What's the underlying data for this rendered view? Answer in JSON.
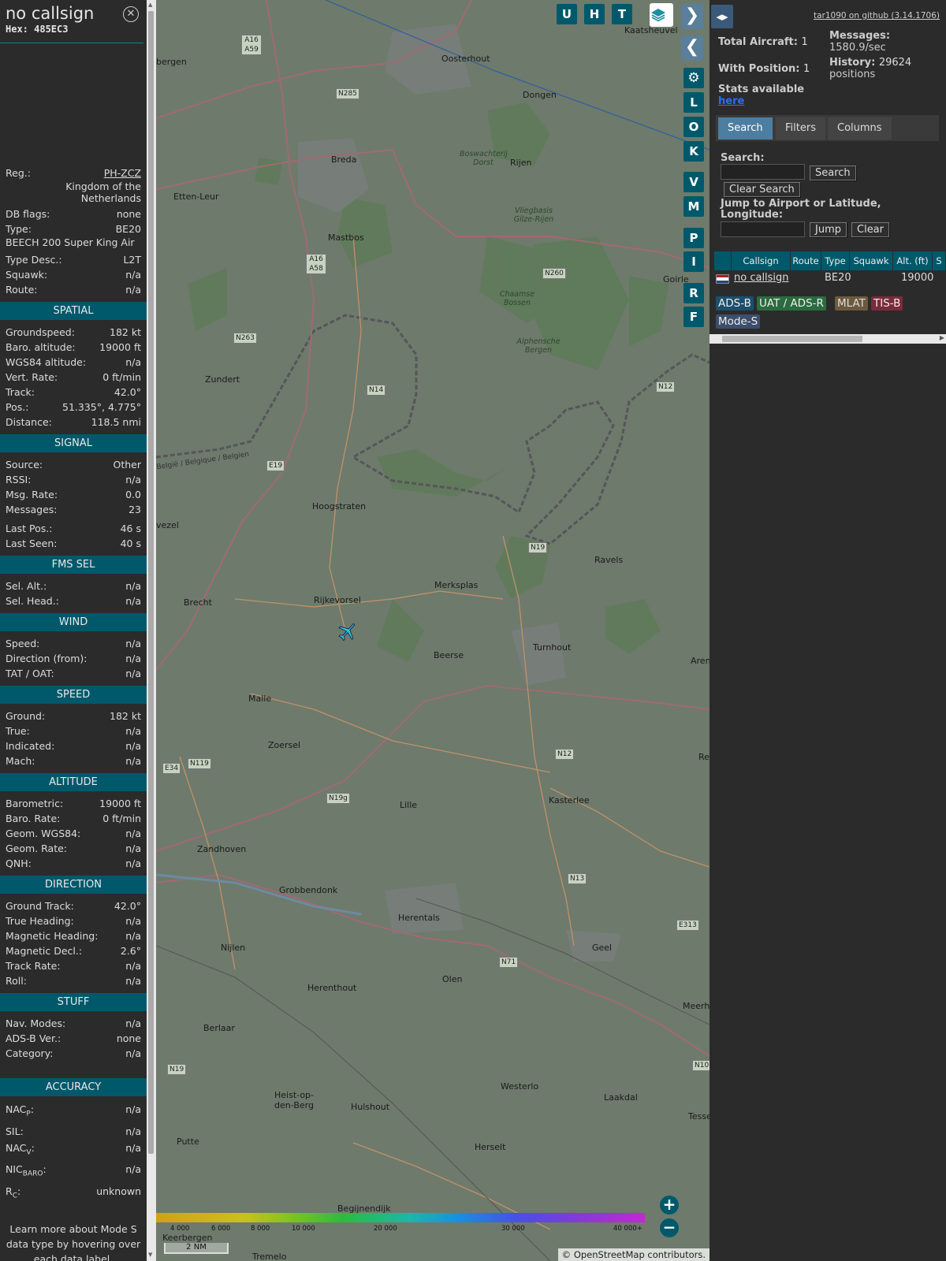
{
  "info": {
    "callsign": "no callsign",
    "hex": "Hex: 485EC3",
    "close_icon": "close-icon",
    "top_rows": [
      {
        "label": "Reg.:",
        "value": "PH-ZCZ"
      },
      {
        "label": "",
        "value": "Kingdom of the Netherlands"
      },
      {
        "label": "DB flags:",
        "value": "none"
      },
      {
        "label": "Type:",
        "value": "BE20"
      },
      {
        "label": "",
        "value": "BEECH 200 Super King Air"
      },
      {
        "label": "Type Desc.:",
        "value": "L2T"
      },
      {
        "label": "Squawk:",
        "value": "n/a"
      },
      {
        "label": "Route:",
        "value": "n/a"
      }
    ],
    "sections": [
      {
        "title": "SPATIAL",
        "rows": [
          {
            "label": "Groundspeed:",
            "value": "182 kt"
          },
          {
            "label": "Baro. altitude:",
            "value": "19000 ft"
          },
          {
            "label": "WGS84 altitude:",
            "value": "n/a"
          },
          {
            "label": "Vert. Rate:",
            "value": "0 ft/min"
          },
          {
            "label": "Track:",
            "value": "42.0°"
          },
          {
            "label": "Pos.:",
            "value": "51.335°, 4.775°"
          },
          {
            "label": "Distance:",
            "value": "118.5 nmi"
          }
        ]
      },
      {
        "title": "SIGNAL",
        "rows": [
          {
            "label": "Source:",
            "value": "Other"
          },
          {
            "label": "RSSI:",
            "value": "n/a"
          },
          {
            "label": "Msg. Rate:",
            "value": "0.0"
          },
          {
            "label": "Messages:",
            "value": "23"
          },
          {
            "label": "Last Pos.:",
            "value": "46 s"
          },
          {
            "label": "Last Seen:",
            "value": "40 s"
          }
        ]
      },
      {
        "title": "FMS SEL",
        "rows": [
          {
            "label": "Sel. Alt.:",
            "value": "n/a"
          },
          {
            "label": "Sel. Head.:",
            "value": "n/a"
          }
        ]
      },
      {
        "title": "WIND",
        "rows": [
          {
            "label": "Speed:",
            "value": "n/a"
          },
          {
            "label": "Direction (from):",
            "value": "n/a"
          },
          {
            "label": "TAT / OAT:",
            "value": "n/a"
          }
        ]
      },
      {
        "title": "SPEED",
        "rows": [
          {
            "label": "Ground:",
            "value": "182 kt"
          },
          {
            "label": "True:",
            "value": "n/a"
          },
          {
            "label": "Indicated:",
            "value": "n/a"
          },
          {
            "label": "Mach:",
            "value": "n/a"
          }
        ]
      },
      {
        "title": "ALTITUDE",
        "rows": [
          {
            "label": "Barometric:",
            "value": "19000 ft"
          },
          {
            "label": "Baro. Rate:",
            "value": "0 ft/min"
          },
          {
            "label": "Geom. WGS84:",
            "value": "n/a"
          },
          {
            "label": "Geom. Rate:",
            "value": "n/a"
          },
          {
            "label": "QNH:",
            "value": "n/a"
          }
        ]
      },
      {
        "title": "DIRECTION",
        "rows": [
          {
            "label": "Ground Track:",
            "value": "42.0°"
          },
          {
            "label": "True Heading:",
            "value": "n/a"
          },
          {
            "label": "Magnetic Heading:",
            "value": "n/a"
          },
          {
            "label": "Magnetic Decl.:",
            "value": "2.6°"
          },
          {
            "label": "Track Rate:",
            "value": "n/a"
          },
          {
            "label": "Roll:",
            "value": "n/a"
          }
        ]
      },
      {
        "title": "STUFF",
        "rows": [
          {
            "label": "Nav. Modes:",
            "value": "n/a"
          },
          {
            "label": "ADS-B Ver.:",
            "value": "none"
          },
          {
            "label": "Category:",
            "value": "n/a"
          }
        ]
      }
    ],
    "accuracy": {
      "title": "ACCURACY",
      "rows": [
        {
          "label": "NAC",
          "sub": "P",
          "value": "n/a"
        },
        {
          "label": "SIL:",
          "sub": "",
          "value": "n/a"
        },
        {
          "label": "NAC",
          "sub": "V",
          "value": "n/a"
        },
        {
          "label": "NIC",
          "sub": "BARO",
          "value": "n/a"
        },
        {
          "label": "R",
          "sub": "C",
          "value": "unknown"
        }
      ]
    },
    "note": "Learn more about Mode S data type by hovering over each data label."
  },
  "map": {
    "buttons": [
      "U",
      "H",
      "T"
    ],
    "side_buttons": [
      "L",
      "O",
      "K",
      "V",
      "M",
      "P",
      "I",
      "R",
      "F"
    ],
    "places": [
      {
        "name": "Oosterhout"
      },
      {
        "name": "Kaatsheuvel"
      },
      {
        "name": "Dongen"
      },
      {
        "name": "Breda"
      },
      {
        "name": "Rijen"
      },
      {
        "name": "Etten-Leur"
      },
      {
        "name": "Mastbos"
      },
      {
        "name": "Vliegbasis Gilze-Rijen"
      },
      {
        "name": "Chaamse Bossen"
      },
      {
        "name": "Alphensche Bergen"
      },
      {
        "name": "Zundert"
      },
      {
        "name": "Goirle"
      },
      {
        "name": "Hoogstraten"
      },
      {
        "name": "Ravels"
      },
      {
        "name": "Merksplas"
      },
      {
        "name": "Rijkevorsel"
      },
      {
        "name": "Brecht"
      },
      {
        "name": "Turnhout"
      },
      {
        "name": "Beerse"
      },
      {
        "name": "Malle"
      },
      {
        "name": "Zoersel"
      },
      {
        "name": "Lille"
      },
      {
        "name": "Kasterlee"
      },
      {
        "name": "Zandhoven"
      },
      {
        "name": "Grobbendonk"
      },
      {
        "name": "Herentals"
      },
      {
        "name": "Geel"
      },
      {
        "name": "Nijlen"
      },
      {
        "name": "Olen"
      },
      {
        "name": "Herenthout"
      },
      {
        "name": "Berlaar"
      },
      {
        "name": "Westerlo"
      },
      {
        "name": "Laakdal"
      },
      {
        "name": "Heist-op-den-Berg"
      },
      {
        "name": "Hulshout"
      },
      {
        "name": "Putte"
      },
      {
        "name": "Herselt"
      },
      {
        "name": "Keerbergen"
      },
      {
        "name": "Tremelo"
      },
      {
        "name": "Begijnendijk"
      },
      {
        "name": "Boswachterij Dorst"
      },
      {
        "name": "bergen"
      },
      {
        "name": "vezel"
      },
      {
        "name": "Aren"
      },
      {
        "name": "Re"
      },
      {
        "name": "Meerho"
      },
      {
        "name": "Tesse"
      },
      {
        "name": "België / Belgique / Belgien"
      }
    ],
    "roads": [
      "A16 A59",
      "N285",
      "A16 A58",
      "N263",
      "N14",
      "E19",
      "N260",
      "N12",
      "N119",
      "N19",
      "N12",
      "E34",
      "N19g",
      "N13",
      "N71",
      "E313",
      "N10",
      "N19"
    ],
    "alt_labels": [
      "4 000",
      "6 000",
      "8 000",
      "10 000",
      "20 000",
      "30 000",
      "40 000+"
    ],
    "scale": "2 NM",
    "attribution": "© OpenStreetMap contributors.",
    "zoom_in": "+",
    "zoom_out": "−"
  },
  "side": {
    "github": "tar1090 on github (3.14.1706)",
    "total_aircraft_label": "Total Aircraft:",
    "total_aircraft": "1",
    "with_position_label": "With Position:",
    "with_position": "1",
    "messages_label": "Messages:",
    "messages": "1580.9/sec",
    "history_label": "History:",
    "history": "29624",
    "history_unit": "positions",
    "stats_label": "Stats available",
    "stats_link": "here",
    "tabs": [
      "Search",
      "Filters",
      "Columns"
    ],
    "search_label": "Search:",
    "search_button": "Search",
    "clear_search": "Clear Search",
    "jump_label": "Jump to Airport or Latitude, Longitude:",
    "jump_button": "Jump",
    "clear_button": "Clear",
    "columns": [
      "Callsign",
      "Route",
      "Type",
      "Squawk",
      "Alt. (ft)",
      "S"
    ],
    "row": {
      "callsign": "no callsign",
      "route": "",
      "type": "BE20",
      "squawk": "",
      "alt": "19000"
    },
    "badges": [
      {
        "label": "ADS-B",
        "bg": "#1d4e6b",
        "fg": "#eee"
      },
      {
        "label": "UAT / ADS-R",
        "bg": "#2b6b3e",
        "fg": "#eee"
      },
      {
        "label": "MLAT",
        "bg": "#6b5a3e",
        "fg": "#ddd"
      },
      {
        "label": "TIS-B",
        "bg": "#7a2b3a",
        "fg": "#eee"
      },
      {
        "label": "Mode-S",
        "bg": "#3b4e6b",
        "fg": "#eee"
      }
    ]
  }
}
